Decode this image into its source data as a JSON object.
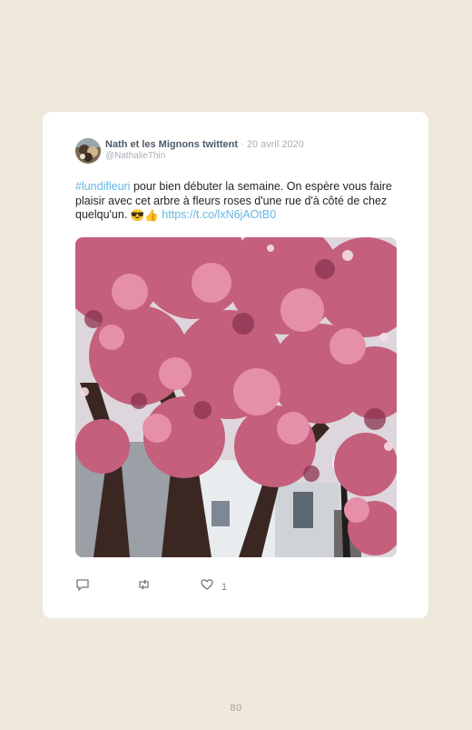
{
  "tweet": {
    "author_name": "Nath et les Mignons twittent",
    "separator": " · ",
    "date": "20 avril 2020",
    "handle": "@NathalieThin",
    "hashtag": "#lundifleuri",
    "text_1": " pour bien débuter la semaine. On espère vous faire plaisir avec cet arbre à fleurs roses d'une rue d'à côté de chez quelqu'un. ",
    "emoji": "😎👍",
    "link": "https://t.co/lxN6jAOtB0",
    "image_alt": "Cerisier du Japon en fleurs roses"
  },
  "actions": {
    "reply_icon": "reply-icon",
    "retweet_icon": "retweet-icon",
    "like_icon": "heart-icon",
    "like_count": "1"
  },
  "page": {
    "number": "80"
  },
  "colors": {
    "background": "#efe9dc",
    "card": "#ffffff",
    "link": "#62b8e5",
    "blossom": "#c45f7c"
  }
}
